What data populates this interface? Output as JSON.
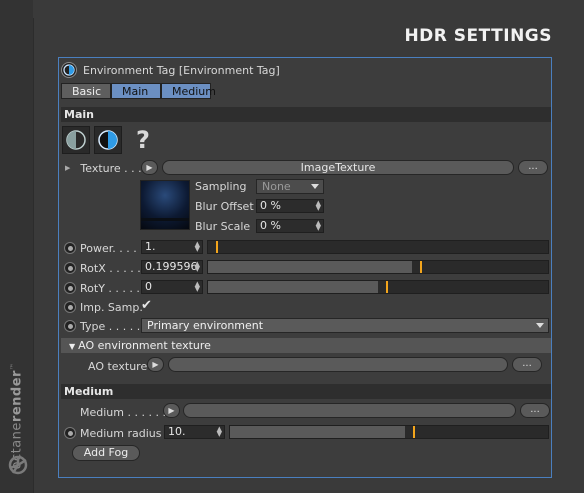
{
  "brand": {
    "text_light": "octane",
    "text_bold": "render",
    "tm": "™"
  },
  "title": "HDR SETTINGS",
  "panel": {
    "header": "Environment Tag [Environment Tag]",
    "tabs": [
      "Basic",
      "Main",
      "Medium"
    ],
    "section_main": "Main",
    "help_glyph": "?",
    "texture": {
      "label": "Texture . . .",
      "button": "ImageTexture",
      "more": "..."
    },
    "sampling": {
      "label": "Sampling",
      "value": "None"
    },
    "blur_offset": {
      "label": "Blur Offset",
      "value": "0 %"
    },
    "blur_scale": {
      "label": "Blur Scale",
      "value": "0 %"
    },
    "power": {
      "label": "Power. . . .",
      "value": "1.",
      "fraction": 0.0
    },
    "rotx": {
      "label": "RotX . . . . .",
      "value": "0.199596",
      "fraction": 0.6
    },
    "roty": {
      "label": "RotY . . . . .",
      "value": "0",
      "fraction": 0.5
    },
    "imp_samp": {
      "label": "Imp. Samp.",
      "checked": "✔"
    },
    "type": {
      "label": "Type . . . . .",
      "value": "Primary environment"
    },
    "ao_section": "AO environment texture",
    "ao_texture": {
      "label": "AO texture",
      "more": "..."
    },
    "section_medium": "Medium",
    "medium": {
      "label": "Medium . . . . . .",
      "more": "..."
    },
    "medium_radius": {
      "label": "Medium radius",
      "value": "10.",
      "fraction": 0.55
    },
    "add_fog": "Add Fog"
  },
  "colors": {
    "accent": "#4a7fbf",
    "knob": "#f3a51c",
    "tab_selected": "#6b8fc2"
  },
  "icons": [
    "environment-tag-icon",
    "octane-half-circle-icon",
    "help-icon",
    "expand-triangle-icon",
    "play-arrow-icon",
    "dropdown-caret-icon"
  ]
}
